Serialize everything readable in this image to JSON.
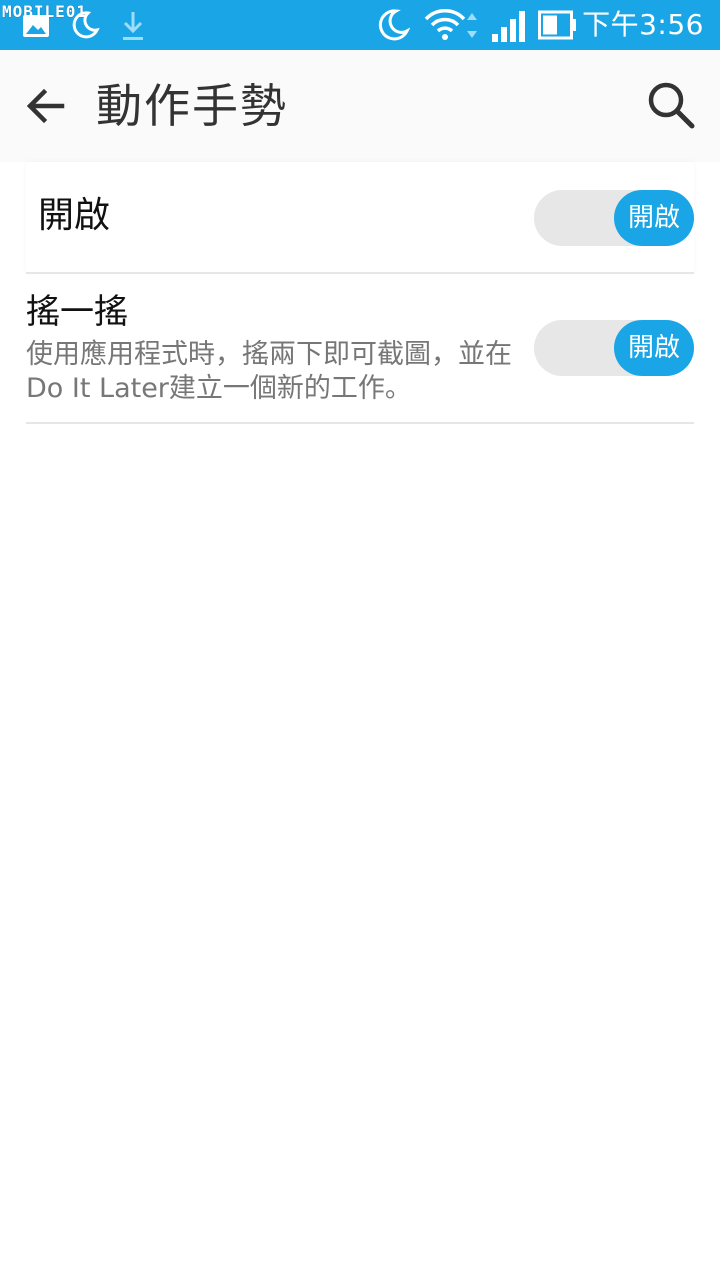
{
  "status_bar": {
    "watermark": "MOBILE01",
    "time": "下午3:56",
    "icons": [
      "gallery-icon",
      "moon-icon",
      "download-icon",
      "moon-icon",
      "wifi-icon",
      "signal-icon",
      "battery-icon"
    ]
  },
  "app_bar": {
    "title": "動作手勢",
    "back_icon": "arrow-back-icon",
    "search_icon": "search-icon"
  },
  "master_switch": {
    "label": "開啟",
    "toggle_label": "開啟",
    "state": "on"
  },
  "settings": [
    {
      "title": "搖一搖",
      "description": "使用應用程式時，搖兩下即可截圖，並在Do It Later建立一個新的工作。",
      "toggle_label": "開啟",
      "state": "on"
    }
  ],
  "colors": {
    "accent": "#1aa6e6",
    "status_bar": "#1aa6e6",
    "toggle_track": "#e7e7e7",
    "title_text": "#333333",
    "secondary_text": "#777777"
  }
}
